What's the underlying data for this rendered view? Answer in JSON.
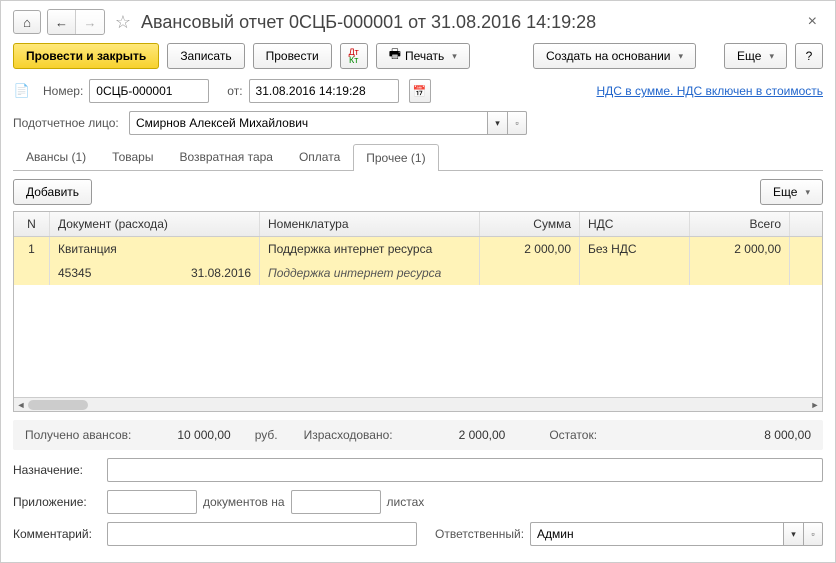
{
  "title": "Авансовый отчет 0СЦБ-000001 от 31.08.2016 14:19:28",
  "toolbar": {
    "post_close": "Провести и закрыть",
    "save": "Записать",
    "post": "Провести",
    "print": "Печать",
    "create_based": "Создать на основании",
    "more": "Еще"
  },
  "header": {
    "number_label": "Номер:",
    "number": "0СЦБ-000001",
    "date_label": "от:",
    "date": "31.08.2016 14:19:28",
    "vat_link": "НДС в сумме. НДС включен в стоимость",
    "person_label": "Подотчетное лицо:",
    "person": "Смирнов Алексей Михайлович"
  },
  "tabs": {
    "advances": "Авансы (1)",
    "goods": "Товары",
    "returnable": "Возвратная тара",
    "payment": "Оплата",
    "other": "Прочее (1)"
  },
  "grid_toolbar": {
    "add": "Добавить",
    "more": "Еще"
  },
  "grid": {
    "cols": {
      "n": "N",
      "doc": "Документ (расхода)",
      "nom": "Номенклатура",
      "sum": "Сумма",
      "nds": "НДС",
      "total": "Всего"
    },
    "row": {
      "n": "1",
      "doc": "Квитанция",
      "nom": "Поддержка интернет ресурса",
      "sum": "2 000,00",
      "nds": "Без НДС",
      "total": "2 000,00",
      "sub_num": "45345",
      "sub_date": "31.08.2016",
      "sub_nom": "Поддержка интернет ресурса"
    }
  },
  "summary": {
    "received_label": "Получено авансов:",
    "received": "10 000,00",
    "currency": "руб.",
    "spent_label": "Израсходовано:",
    "spent": "2 000,00",
    "rest_label": "Остаток:",
    "rest": "8 000,00"
  },
  "footer": {
    "purpose_label": "Назначение:",
    "purpose": "",
    "attachment_label": "Приложение:",
    "attachment_count": "",
    "docs_on": "документов на",
    "sheets_count": "",
    "sheets": "листах",
    "comment_label": "Комментарий:",
    "comment": "",
    "responsible_label": "Ответственный:",
    "responsible": "Админ"
  }
}
